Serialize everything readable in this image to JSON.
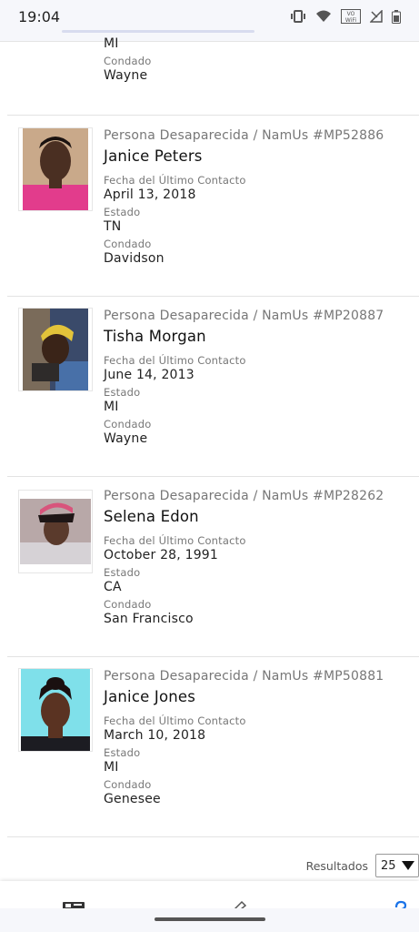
{
  "status_bar": {
    "time": "19:04",
    "network_badge": "VO WiFi"
  },
  "partial_record": {
    "estado_value": "MI",
    "condado_label": "Condado",
    "condado_value": "Wayne"
  },
  "records": [
    {
      "case": "Persona Desaparecida / NamUs #MP52886",
      "name": "Janice Peters",
      "contact_label": "Fecha del Último Contacto",
      "contact_value": "April 13, 2018",
      "state_label": "Estado",
      "state_value": "TN",
      "county_label": "Condado",
      "county_value": "Davidson"
    },
    {
      "case": "Persona Desaparecida / NamUs #MP20887",
      "name": "Tisha Morgan",
      "contact_label": "Fecha del Último Contacto",
      "contact_value": "June 14, 2013",
      "state_label": "Estado",
      "state_value": "MI",
      "county_label": "Condado",
      "county_value": "Wayne"
    },
    {
      "case": "Persona Desaparecida / NamUs #MP28262",
      "name": "Selena Edon",
      "contact_label": "Fecha del Último Contacto",
      "contact_value": "October 28, 1991",
      "state_label": "Estado",
      "state_value": "CA",
      "county_label": "Condado",
      "county_value": "San Francisco"
    },
    {
      "case": "Persona Desaparecida / NamUs #MP50881",
      "name": "Janice Jones",
      "contact_label": "Fecha del Último Contacto",
      "contact_value": "March 10, 2018",
      "state_label": "Estado",
      "state_value": "MI",
      "county_label": "Condado",
      "county_value": "Genesee"
    }
  ],
  "footer": {
    "results_label": "Resultados",
    "results_value": "25"
  },
  "icons": {
    "status": [
      "vibrate-icon",
      "wifi-icon",
      "vowifi-icon",
      "no-signal-icon",
      "battery-icon"
    ],
    "bottom_nav": [
      "id-card-icon",
      "pen-icon",
      "help-icon"
    ]
  },
  "colors": {
    "accent": "#1a73e8",
    "muted_text": "#777777",
    "divider": "#e3e3e3"
  }
}
